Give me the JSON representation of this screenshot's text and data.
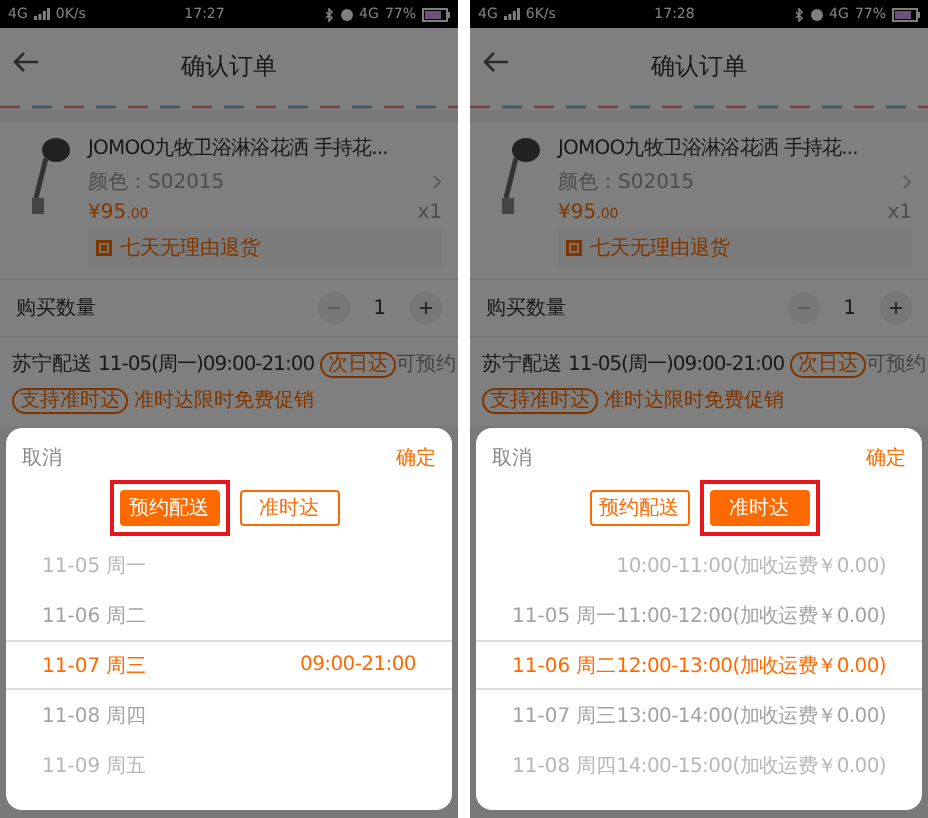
{
  "panels": [
    {
      "status_bar": {
        "network": "4G",
        "speed": "0K/s",
        "time": "17:27",
        "network_right": "4G",
        "battery": "77%"
      },
      "header": {
        "title": "确认订单"
      },
      "product": {
        "name": "JOMOO九牧卫浴淋浴花洒 手持花...",
        "variant": "颜色：S02015",
        "price": "¥95",
        "price_cents": ".00",
        "qty": "x1",
        "badge": "七天无理由退货"
      },
      "quantity": {
        "label": "购买数量",
        "value": "1"
      },
      "delivery": {
        "label": "苏宁配送",
        "time": "11-05(周一)09:00-21:00",
        "tag": "次日达",
        "status": "可预约",
        "tag2": "支持准时达",
        "note": "准时达限时免费促销"
      },
      "sheet": {
        "cancel": "取消",
        "confirm": "确定",
        "modes": [
          {
            "label": "预约配送",
            "selected": true,
            "highlighted": true
          },
          {
            "label": "准时达",
            "selected": false,
            "highlighted": false
          }
        ],
        "rows": [
          {
            "date": "11-05 周一",
            "selected": false
          },
          {
            "date": "11-06 周二",
            "selected": false
          },
          {
            "date": "11-07 周三",
            "time": "09:00-21:00",
            "selected": true
          },
          {
            "date": "11-08 周四",
            "selected": false
          },
          {
            "date": "11-09 周五",
            "selected": false
          }
        ]
      }
    },
    {
      "status_bar": {
        "network": "4G",
        "speed": "6K/s",
        "time": "17:28",
        "network_right": "4G",
        "battery": "77%"
      },
      "header": {
        "title": "确认订单"
      },
      "product": {
        "name": "JOMOO九牧卫浴淋浴花洒 手持花...",
        "variant": "颜色：S02015",
        "price": "¥95",
        "price_cents": ".00",
        "qty": "x1",
        "badge": "七天无理由退货"
      },
      "quantity": {
        "label": "购买数量",
        "value": "1"
      },
      "delivery": {
        "label": "苏宁配送",
        "time": "11-05(周一)09:00-21:00",
        "tag": "次日达",
        "status": "可预约",
        "tag2": "支持准时达",
        "note": "准时达限时免费促销"
      },
      "sheet": {
        "cancel": "取消",
        "confirm": "确定",
        "modes": [
          {
            "label": "预约配送",
            "selected": false,
            "highlighted": false
          },
          {
            "label": "准时达",
            "selected": true,
            "highlighted": true
          }
        ],
        "rows": [
          {
            "time": "10:00-11:00(加收运费￥0.00)",
            "selected": false
          },
          {
            "date": "11-05 周一",
            "time": "11:00-12:00(加收运费￥0.00)",
            "selected": false
          },
          {
            "date": "11-06 周二",
            "time": "12:00-13:00(加收运费￥0.00)",
            "selected": true
          },
          {
            "date": "11-07 周三",
            "time": "13:00-14:00(加收运费￥0.00)",
            "selected": false
          },
          {
            "date": "11-08 周四",
            "time": "14:00-15:00(加收运费￥0.00)",
            "selected": false
          }
        ]
      }
    }
  ]
}
